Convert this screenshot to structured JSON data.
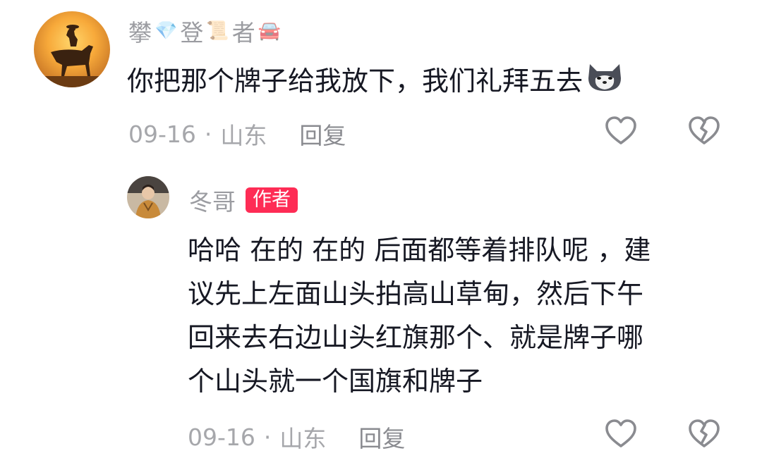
{
  "comments": [
    {
      "username_parts": [
        "攀",
        "登",
        "者"
      ],
      "text": "你把那个牌子给我放下，我们礼拜五去",
      "date": "09-16",
      "separator": "·",
      "location": "山东",
      "reply_label": "回复"
    }
  ],
  "reply": {
    "username": "冬哥",
    "badge": "作者",
    "text_lines": [
      "哈哈 在的 在的 后面都等着排队呢 ，建",
      "议先上左面山头拍高山草甸，然后下午",
      "回来去右边山头红旗那个、就是牌子哪",
      "个山头就一个国旗和牌子"
    ],
    "date": "09-16",
    "separator": "·",
    "location": "山东",
    "reply_label": "回复"
  },
  "colors": {
    "badge": "#fe2c55",
    "meta_text": "#a6a7ab",
    "body_text": "#161823"
  },
  "icons": [
    "horse-rider-avatar",
    "diamond-emoji-icon",
    "scroll-emoji-icon",
    "car-emoji-icon",
    "husky-emoji-icon",
    "heart-icon",
    "broken-heart-icon",
    "user-avatar"
  ]
}
